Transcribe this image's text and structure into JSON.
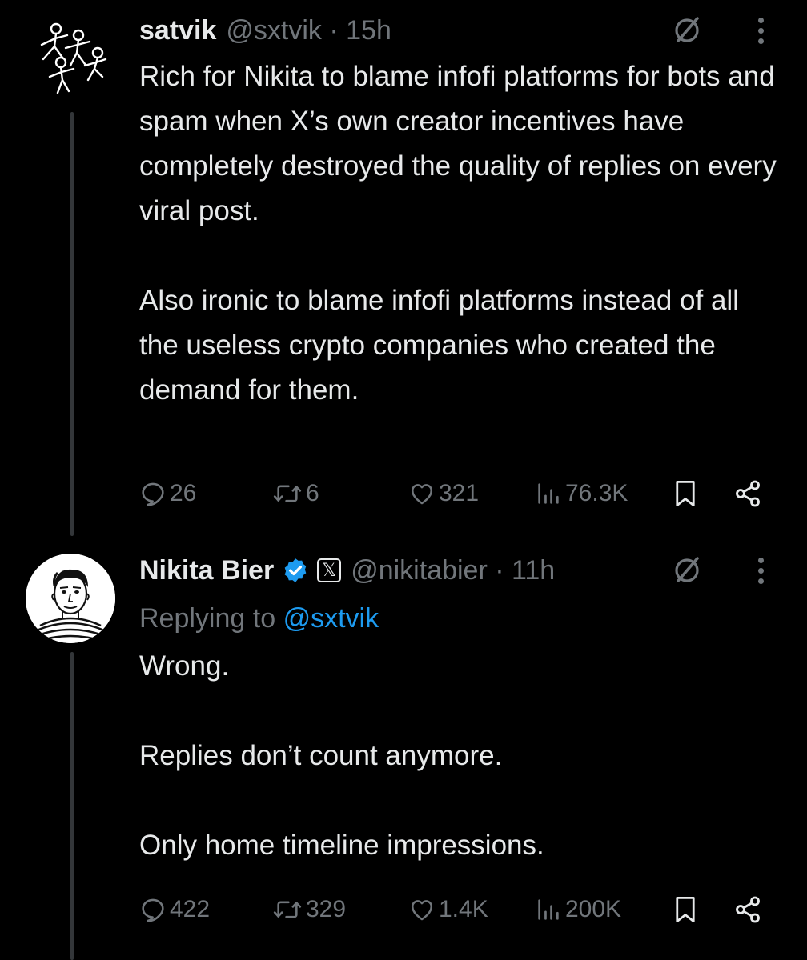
{
  "colors": {
    "background": "#000000",
    "text_primary": "#e7e9ea",
    "text_secondary": "#71767b",
    "accent": "#1d9bf0",
    "thread_line": "#333639"
  },
  "posts": [
    {
      "author": {
        "name": "satvik",
        "handle": "@sxtvik",
        "time": "15h",
        "avatar": "stick-figure-drawing-avatar"
      },
      "paragraphs": [
        "Rich for Nikita to blame infofi platforms for bots and spam when X’s own creator incentives have completely destroyed the quality of replies on every viral post.",
        "Also ironic to blame infofi platforms instead of all the useless crypto companies who created the demand for them."
      ],
      "stats": {
        "replies": "26",
        "reposts": "6",
        "likes": "321",
        "views": "76.3K"
      }
    },
    {
      "author": {
        "name": "Nikita Bier",
        "handle": "@nikitabier",
        "time": "11h",
        "avatar": "sketch-portrait-avatar",
        "verified": true,
        "affiliate_badge": "𝕏"
      },
      "replying_prefix": "Replying to",
      "replying_to": "@sxtvik",
      "paragraphs": [
        "Wrong.",
        "Replies don’t count anymore.",
        "Only home timeline impressions."
      ],
      "stats": {
        "replies": "422",
        "reposts": "329",
        "likes": "1.4K",
        "views": "200K"
      }
    }
  ],
  "icons": {
    "grok": "grok-icon",
    "more": "more-icon",
    "reply": "reply-icon",
    "repost": "repost-icon",
    "like": "like-icon",
    "views": "views-icon",
    "bookmark": "bookmark-icon",
    "share": "share-icon",
    "verified": "verified-badge-icon"
  }
}
